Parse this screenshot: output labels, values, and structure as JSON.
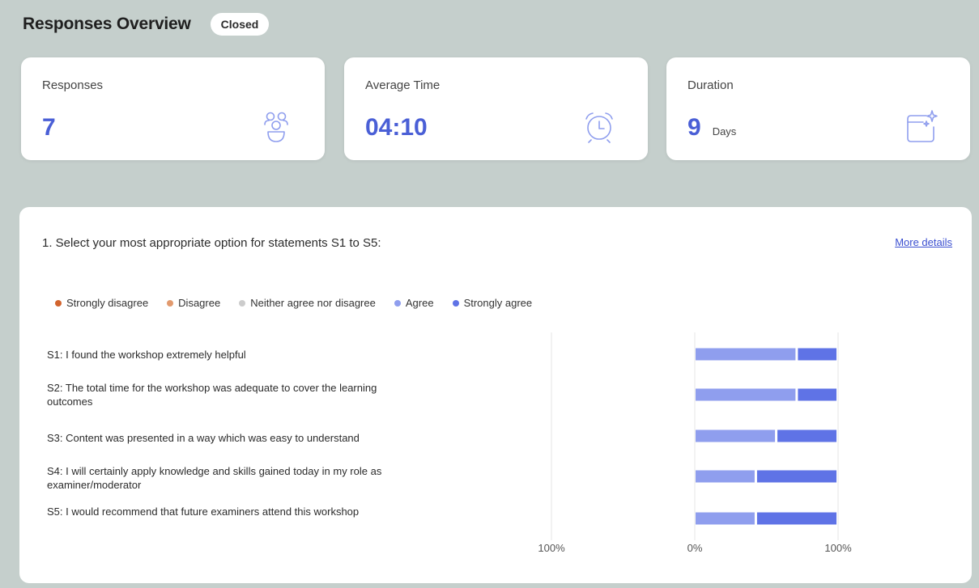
{
  "header": {
    "title": "Responses Overview",
    "status": "Closed"
  },
  "cards": {
    "responses": {
      "label": "Responses",
      "value": "7",
      "icon": "people-group-icon"
    },
    "average_time": {
      "label": "Average Time",
      "value": "04:10",
      "icon": "alarm-clock-icon"
    },
    "duration": {
      "label": "Duration",
      "value": "9",
      "unit": "Days",
      "icon": "calendar-sparkle-icon"
    }
  },
  "accent_color": "#4a5fd6",
  "question": {
    "text": "1. Select your most appropriate option for statements S1 to S5:",
    "more_details": "More details"
  },
  "chart_data": {
    "type": "bar",
    "orientation": "horizontal",
    "stacked": true,
    "diverging": true,
    "legend_placement": "top",
    "categories": [
      "S1: I found the workshop extremely helpful",
      "S2: The total time for the workshop was adequate to cover the learning outcomes",
      "S3: Content was presented in a way which was easy to understand",
      "S4: I will certainly apply knowledge and skills gained today in my role as examiner/moderator",
      "S5: I would recommend that future examiners attend this workshop"
    ],
    "series": [
      {
        "name": "Strongly disagree",
        "color": "#d2642e",
        "values": [
          0,
          0,
          0,
          0,
          0
        ]
      },
      {
        "name": "Disagree",
        "color": "#e29a6e",
        "values": [
          0,
          0,
          0,
          0,
          0
        ]
      },
      {
        "name": "Neither agree nor disagree",
        "color": "#cccccc",
        "values": [
          0,
          0,
          0,
          0,
          0
        ]
      },
      {
        "name": "Agree",
        "color": "#8f9eee",
        "values": [
          71.4,
          71.4,
          57.1,
          42.9,
          42.9
        ]
      },
      {
        "name": "Strongly agree",
        "color": "#5f73e6",
        "values": [
          28.6,
          28.6,
          42.9,
          57.1,
          57.1
        ]
      }
    ],
    "x_tick_labels": [
      "100%",
      "0%",
      "100%"
    ],
    "xlim": [
      -100,
      100
    ],
    "grid": true
  }
}
